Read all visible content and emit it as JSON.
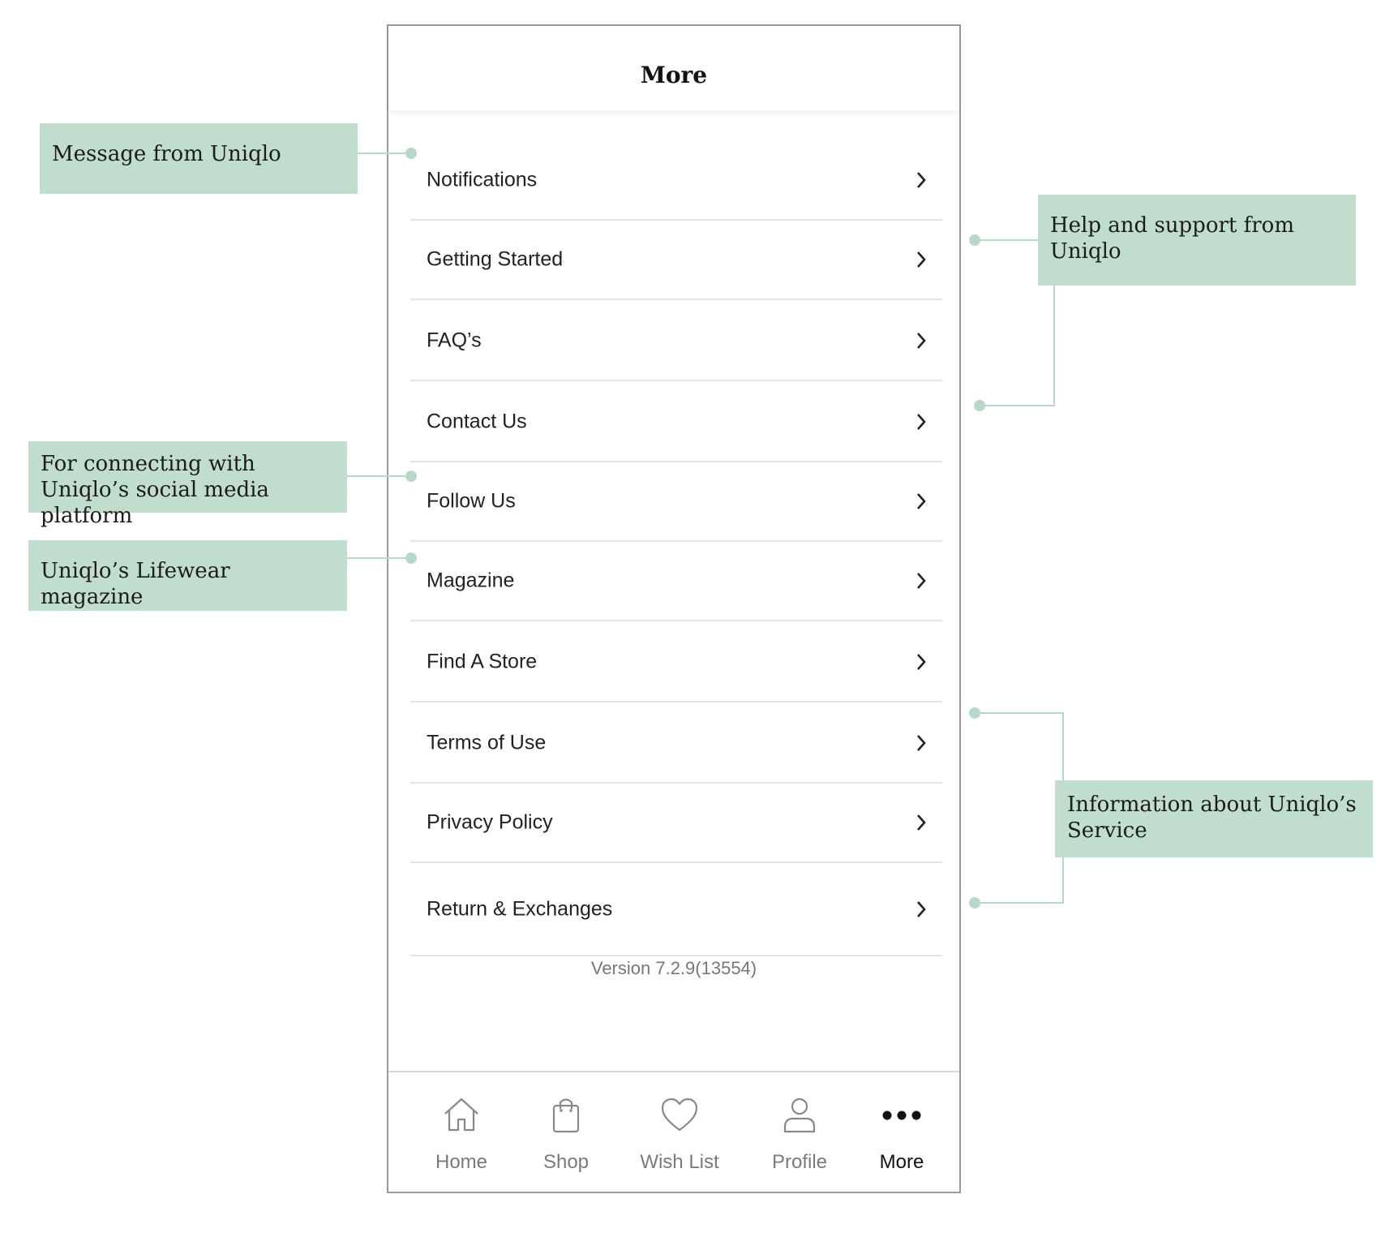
{
  "header": {
    "title": "More"
  },
  "menu": [
    {
      "label": "Notifications"
    },
    {
      "label": "Getting Started"
    },
    {
      "label": "FAQ’s"
    },
    {
      "label": "Contact Us"
    },
    {
      "label": "Follow Us"
    },
    {
      "label": "Magazine"
    },
    {
      "label": "Find A Store"
    },
    {
      "label": "Terms of Use"
    },
    {
      "label": "Privacy Policy"
    },
    {
      "label": "Return & Exchanges"
    }
  ],
  "version": "Version 7.2.9(13554)",
  "tabbar": [
    {
      "label": "Home",
      "icon": "home-icon"
    },
    {
      "label": "Shop",
      "icon": "shopping-bag-icon"
    },
    {
      "label": "Wish List",
      "icon": "heart-icon"
    },
    {
      "label": "Profile",
      "icon": "user-icon"
    },
    {
      "label": "More",
      "icon": "more-dots-icon",
      "active": true
    }
  ],
  "annotations": {
    "notifications": "Message from Uniqlo",
    "help": "Help and support from Uniqlo",
    "follow": "For connecting with Uniqlo’s social media platform",
    "magazine": "Uniqlo’s Lifewear magazine",
    "service": "Information about Uniqlo’s Service"
  },
  "colors": {
    "annotation_bg": "#c0ddcd",
    "annotation_line": "#b8d9c7",
    "frame": "#9a9a9a"
  }
}
